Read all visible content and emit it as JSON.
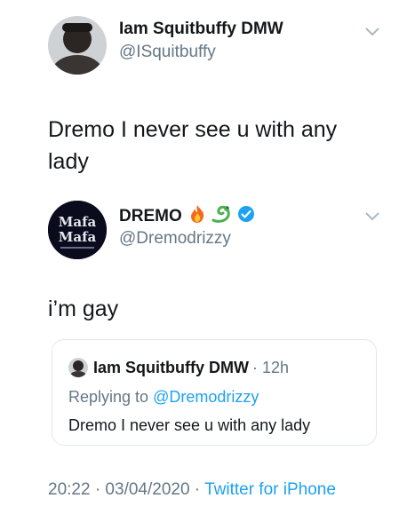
{
  "tweet": {
    "author_name": "Iam Squitbuffy DMW",
    "author_handle": "@ISquitbuffy",
    "text": "Dremo I never see u with any lady"
  },
  "reply": {
    "author_name": "DREMO",
    "author_handle": "@Dremodrizzy",
    "avatar_text_line1": "Mafa",
    "avatar_text_line2": "Mafa",
    "text": "i’m gay",
    "verified": true,
    "name_emojis": [
      "fire-icon",
      "dragon-icon"
    ]
  },
  "quoted": {
    "author_name": "Iam Squitbuffy DMW",
    "time": "· 12h",
    "replying_prefix": "Replying to ",
    "replying_to": "@Dremodrizzy",
    "text": "Dremo I never see u with any lady"
  },
  "meta": {
    "timestamp": "20:22 · 03/04/2020 · ",
    "source": "Twitter for iPhone"
  },
  "colors": {
    "link_blue": "#1da1f2",
    "secondary_text": "#657786",
    "border": "#e1e8ed"
  }
}
